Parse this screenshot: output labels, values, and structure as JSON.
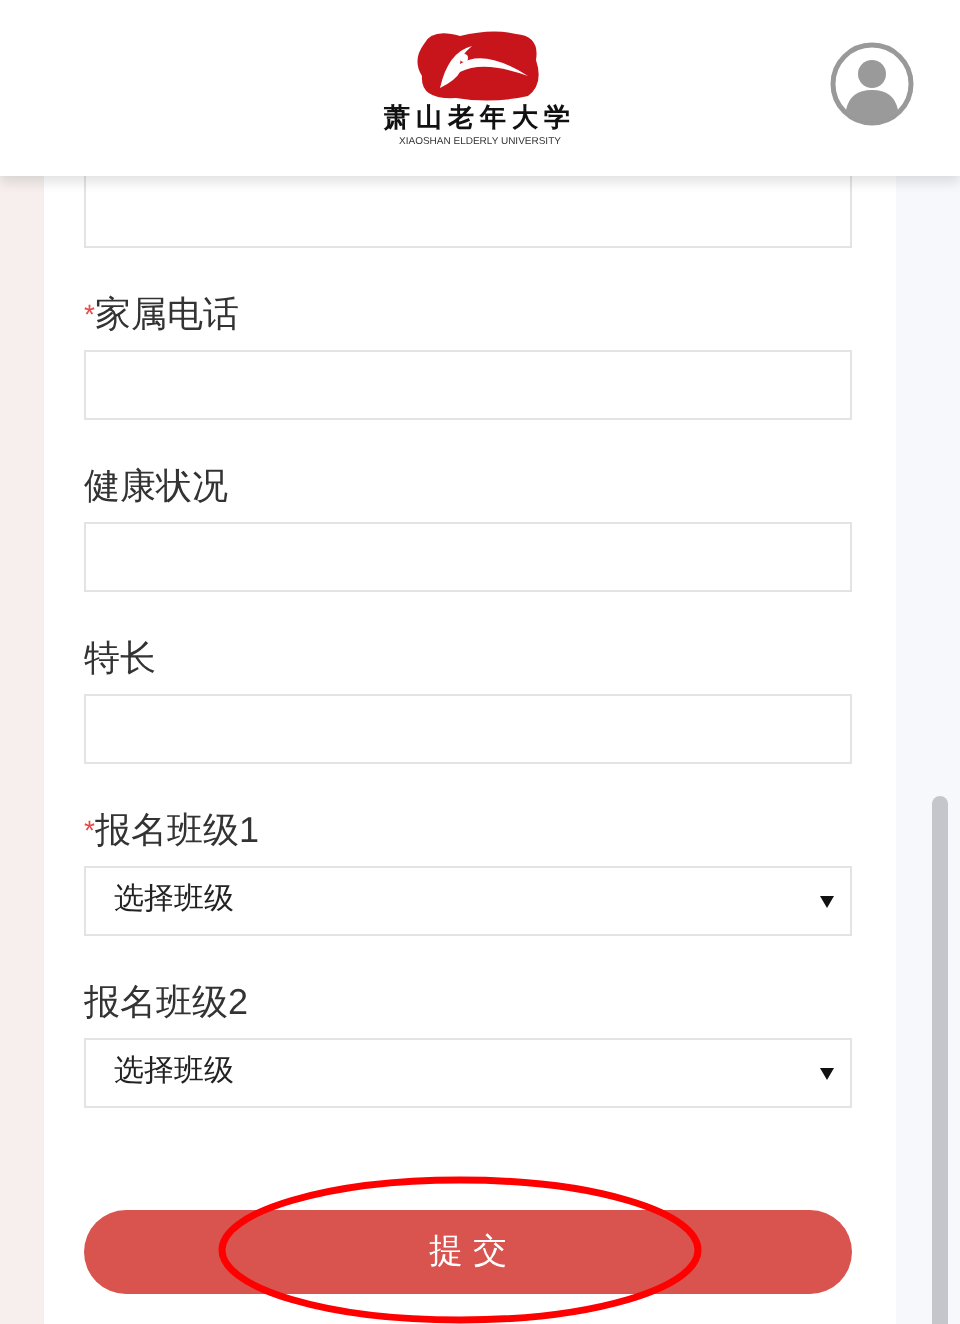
{
  "header": {
    "logo_title": "萧山老年大学",
    "logo_subtitle": "XIAOSHAN ELDERLY UNIVERSITY"
  },
  "fields": [
    {
      "kind": "input",
      "label": "家属电话",
      "required": true
    },
    {
      "kind": "input",
      "label": "健康状况",
      "required": false
    },
    {
      "kind": "input",
      "label": "特长",
      "required": false
    },
    {
      "kind": "select",
      "label": "报名班级1",
      "required": true,
      "value": "选择班级"
    },
    {
      "kind": "select",
      "label": "报名班级2",
      "required": false,
      "value": "选择班级"
    }
  ],
  "required_mark": "*",
  "submit": {
    "label": "提 交"
  }
}
